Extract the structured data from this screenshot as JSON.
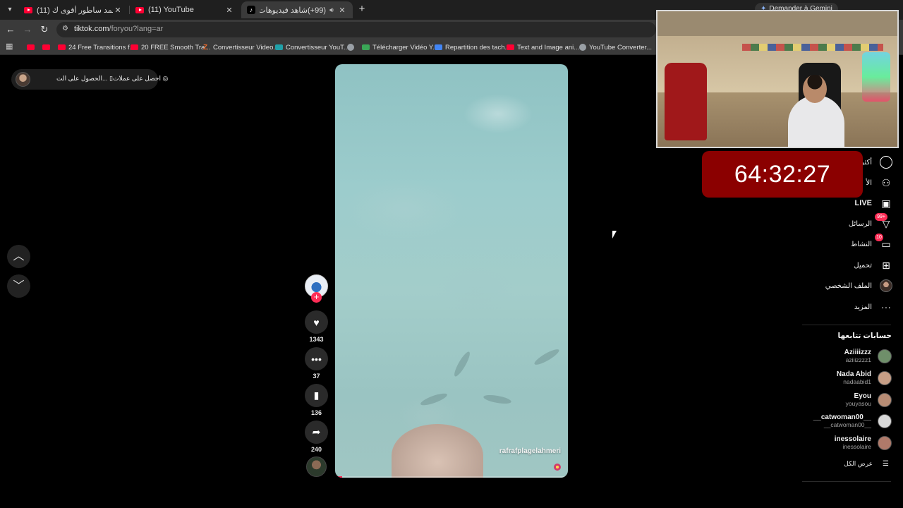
{
  "browser": {
    "tabs": [
      {
        "label": "(11) لاباس - حمد ساطور أقوى ك",
        "active": false
      },
      {
        "label": "(11) YouTube",
        "active": false
      },
      {
        "label": "(99+)شاهد فيديوهات متصد",
        "active": true
      }
    ],
    "gemini_label": "Demander à Gemini",
    "url_host": "tiktok.com",
    "url_path": "/foryou?lang=ar",
    "bookmarks": [
      {
        "label": "",
        "icon": "youtube-icon"
      },
      {
        "label": "",
        "icon": "youtube-icon"
      },
      {
        "label": "24 Free Transitions f...",
        "icon": "youtube-icon"
      },
      {
        "label": "20 FREE Smooth Tra...",
        "icon": "youtube-icon"
      },
      {
        "label": "Convertisseur Video...",
        "icon": "z-icon"
      },
      {
        "label": "Convertisseur YouT...",
        "icon": "converter-icon"
      },
      {
        "label": "",
        "icon": "globe-icon"
      },
      {
        "label": "Télécharger Vidéo Y...",
        "icon": "download-icon"
      },
      {
        "label": "Repartition des tach...",
        "icon": "docs-icon"
      },
      {
        "label": "Text and Image ani...",
        "icon": "youtube-icon"
      },
      {
        "label": "YouTube Converter...",
        "icon": "globe-icon"
      }
    ]
  },
  "tiktok": {
    "top_pill": {
      "link_get_coins": "احصل على عملات",
      "link_get_app": "الحصول على الت..."
    },
    "video": {
      "credit": "rafrafplagelahmeri",
      "progress_fraction": 0.03
    },
    "actions": {
      "likes": "1343",
      "comments": "37",
      "saves": "136",
      "shares": "240"
    },
    "nav": [
      {
        "label": "أكثر",
        "icon": "foryou-icon"
      },
      {
        "label": "الأ",
        "icon": "friends-icon"
      },
      {
        "label": "LIVE",
        "icon": "live-icon"
      },
      {
        "label": "الرسائل",
        "icon": "send-icon",
        "badge": "99+"
      },
      {
        "label": "النشاط",
        "icon": "inbox-icon",
        "badge": "10"
      },
      {
        "label": "تحميل",
        "icon": "upload-icon"
      },
      {
        "label": "الملف الشخصي",
        "icon": "profile-avatar"
      },
      {
        "label": "المزيد",
        "icon": "more-icon"
      }
    ],
    "following_title": "حسابات تتابعها",
    "following": [
      {
        "name": "Aziiiizzz",
        "handle": "aziiizzzz1",
        "color": "#6f8f6a"
      },
      {
        "name": "Nada Abid",
        "handle": "nadaabid1",
        "color": "#c79e86"
      },
      {
        "name": "Eyou",
        "handle": "youyasou",
        "color": "#b88c74"
      },
      {
        "name": "__catwoman00__",
        "handle": "__catwoman00__",
        "color": "#d8d8d8"
      },
      {
        "name": "inessolaire",
        "handle": "inessolaire",
        "color": "#b07a6a"
      }
    ],
    "see_all": "عرض الكل"
  },
  "stream": {
    "timer": "64:32:27"
  },
  "colors": {
    "accent": "#fe2c55",
    "timer_bg": "#8b0000"
  }
}
